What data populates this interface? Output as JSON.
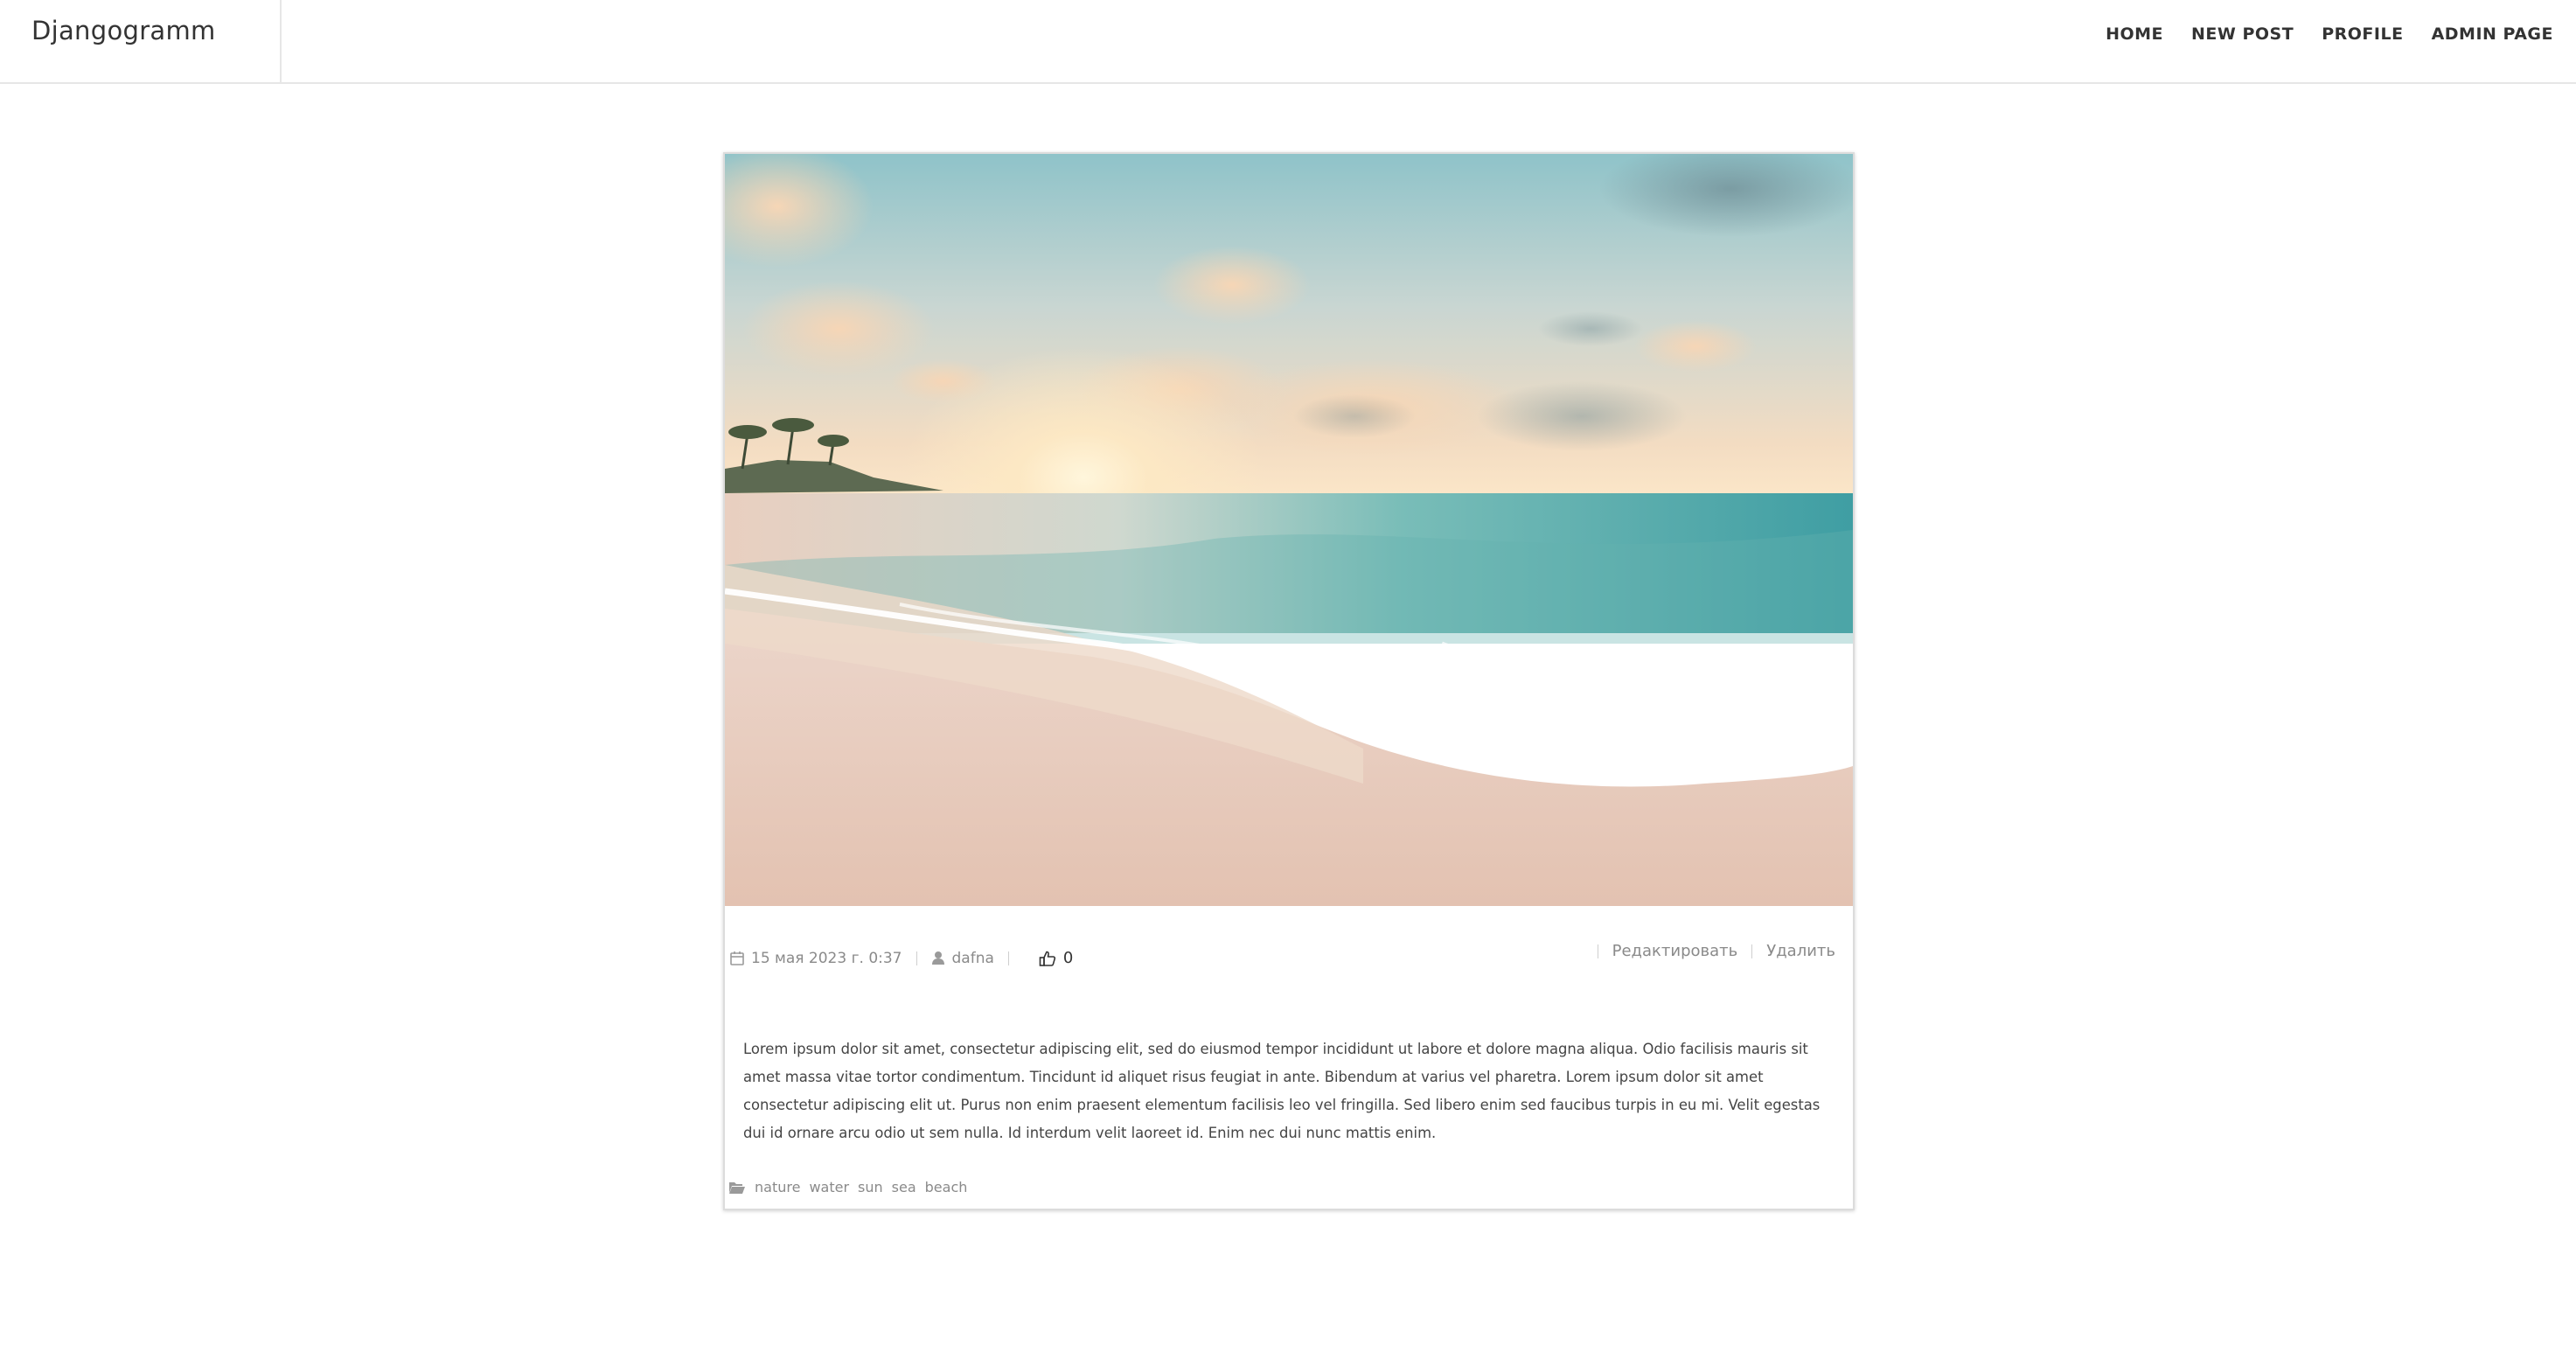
{
  "brand": "Djangogramm",
  "nav": {
    "home": "HOME",
    "new_post": "NEW POST",
    "profile": "PROFILE",
    "admin_page": "ADMIN PAGE"
  },
  "post": {
    "image_alt": "Beach at sunset with waves",
    "date": "15 мая 2023 г. 0:37",
    "author": "dafna",
    "likes": "0",
    "edit_label": "Редактировать",
    "delete_label": "Удалить",
    "body": "Lorem ipsum dolor sit amet, consectetur adipiscing elit, sed do eiusmod tempor incididunt ut labore et dolore magna aliqua. Odio facilisis mauris sit amet massa vitae tortor condimentum. Tincidunt id aliquet risus feugiat in ante. Bibendum at varius vel pharetra. Lorem ipsum dolor sit amet consectetur adipiscing elit ut. Purus non enim praesent elementum facilisis leo vel fringilla. Sed libero enim sed faucibus turpis in eu mi. Velit egestas dui id ornare arcu odio ut sem nulla. Id interdum velit laoreet id. Enim nec dui nunc mattis enim.",
    "tags": [
      "nature",
      "water",
      "sun",
      "sea",
      "beach"
    ]
  },
  "icons": {
    "calendar": "calendar-icon",
    "user": "user-icon",
    "like": "thumbs-up-icon",
    "folder": "folder-open-icon"
  },
  "colors": {
    "text": "#333333",
    "muted": "#8a8a8a",
    "border": "#e6e6e6"
  }
}
